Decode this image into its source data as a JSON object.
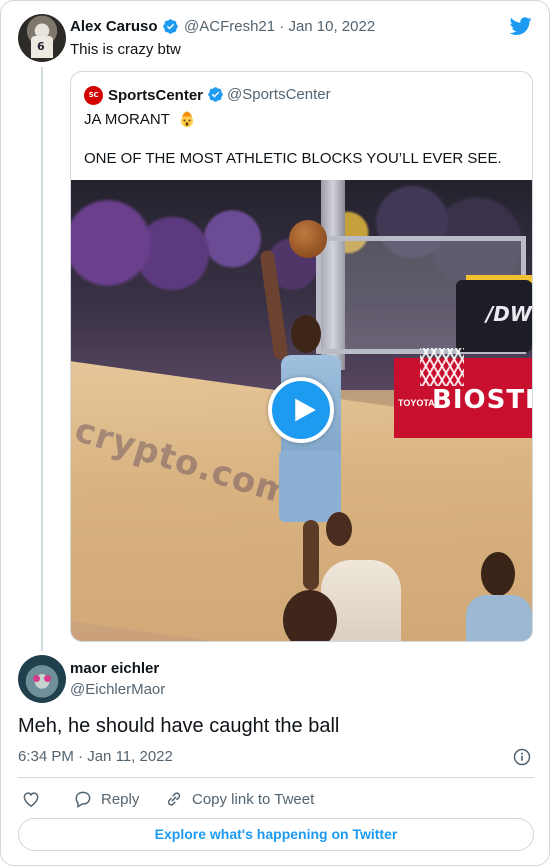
{
  "parent_tweet": {
    "author_name": "Alex Caruso",
    "author_handle": "@ACFresh21",
    "date": "Jan 10, 2022",
    "separator": "·",
    "text": "This is crazy btw",
    "avatar_jersey_number": "6"
  },
  "quoted_tweet": {
    "author_name": "SportsCenter",
    "author_handle": "@SportsCenter",
    "logo_text": "SC",
    "line1": "JA MORANT",
    "line2": "ONE OF THE MOST ATHLETIC BLOCKS YOU’LL EVER SEE.",
    "video": {
      "ad_text": "BIOSTEE",
      "ad_small_text": "TOYOTA",
      "court_text": "crypto.com",
      "stanchion_text": "/DW"
    }
  },
  "reply_tweet": {
    "author_name": "maor eichler",
    "author_handle": "@EichlerMaor",
    "text": "Meh, he should have caught the ball",
    "time": "6:34 PM",
    "date": "Jan 11, 2022",
    "separator": "·"
  },
  "actions": {
    "reply_label": "Reply",
    "copy_label": "Copy link to Tweet"
  },
  "footer": {
    "explore_label": "Explore what's happening on Twitter"
  },
  "icons": {
    "brand": "twitter-bird-icon",
    "verified": "verified-badge-icon",
    "like": "heart-icon",
    "reply": "speech-bubble-icon",
    "copy": "link-icon",
    "info": "info-icon",
    "play": "play-icon",
    "emoji": "exploding-head-emoji"
  },
  "colors": {
    "accent": "#1d9bf0",
    "text": "#0f1419",
    "secondary_text": "#536471",
    "border": "#cfd9de",
    "espn_red": "#d40000"
  }
}
